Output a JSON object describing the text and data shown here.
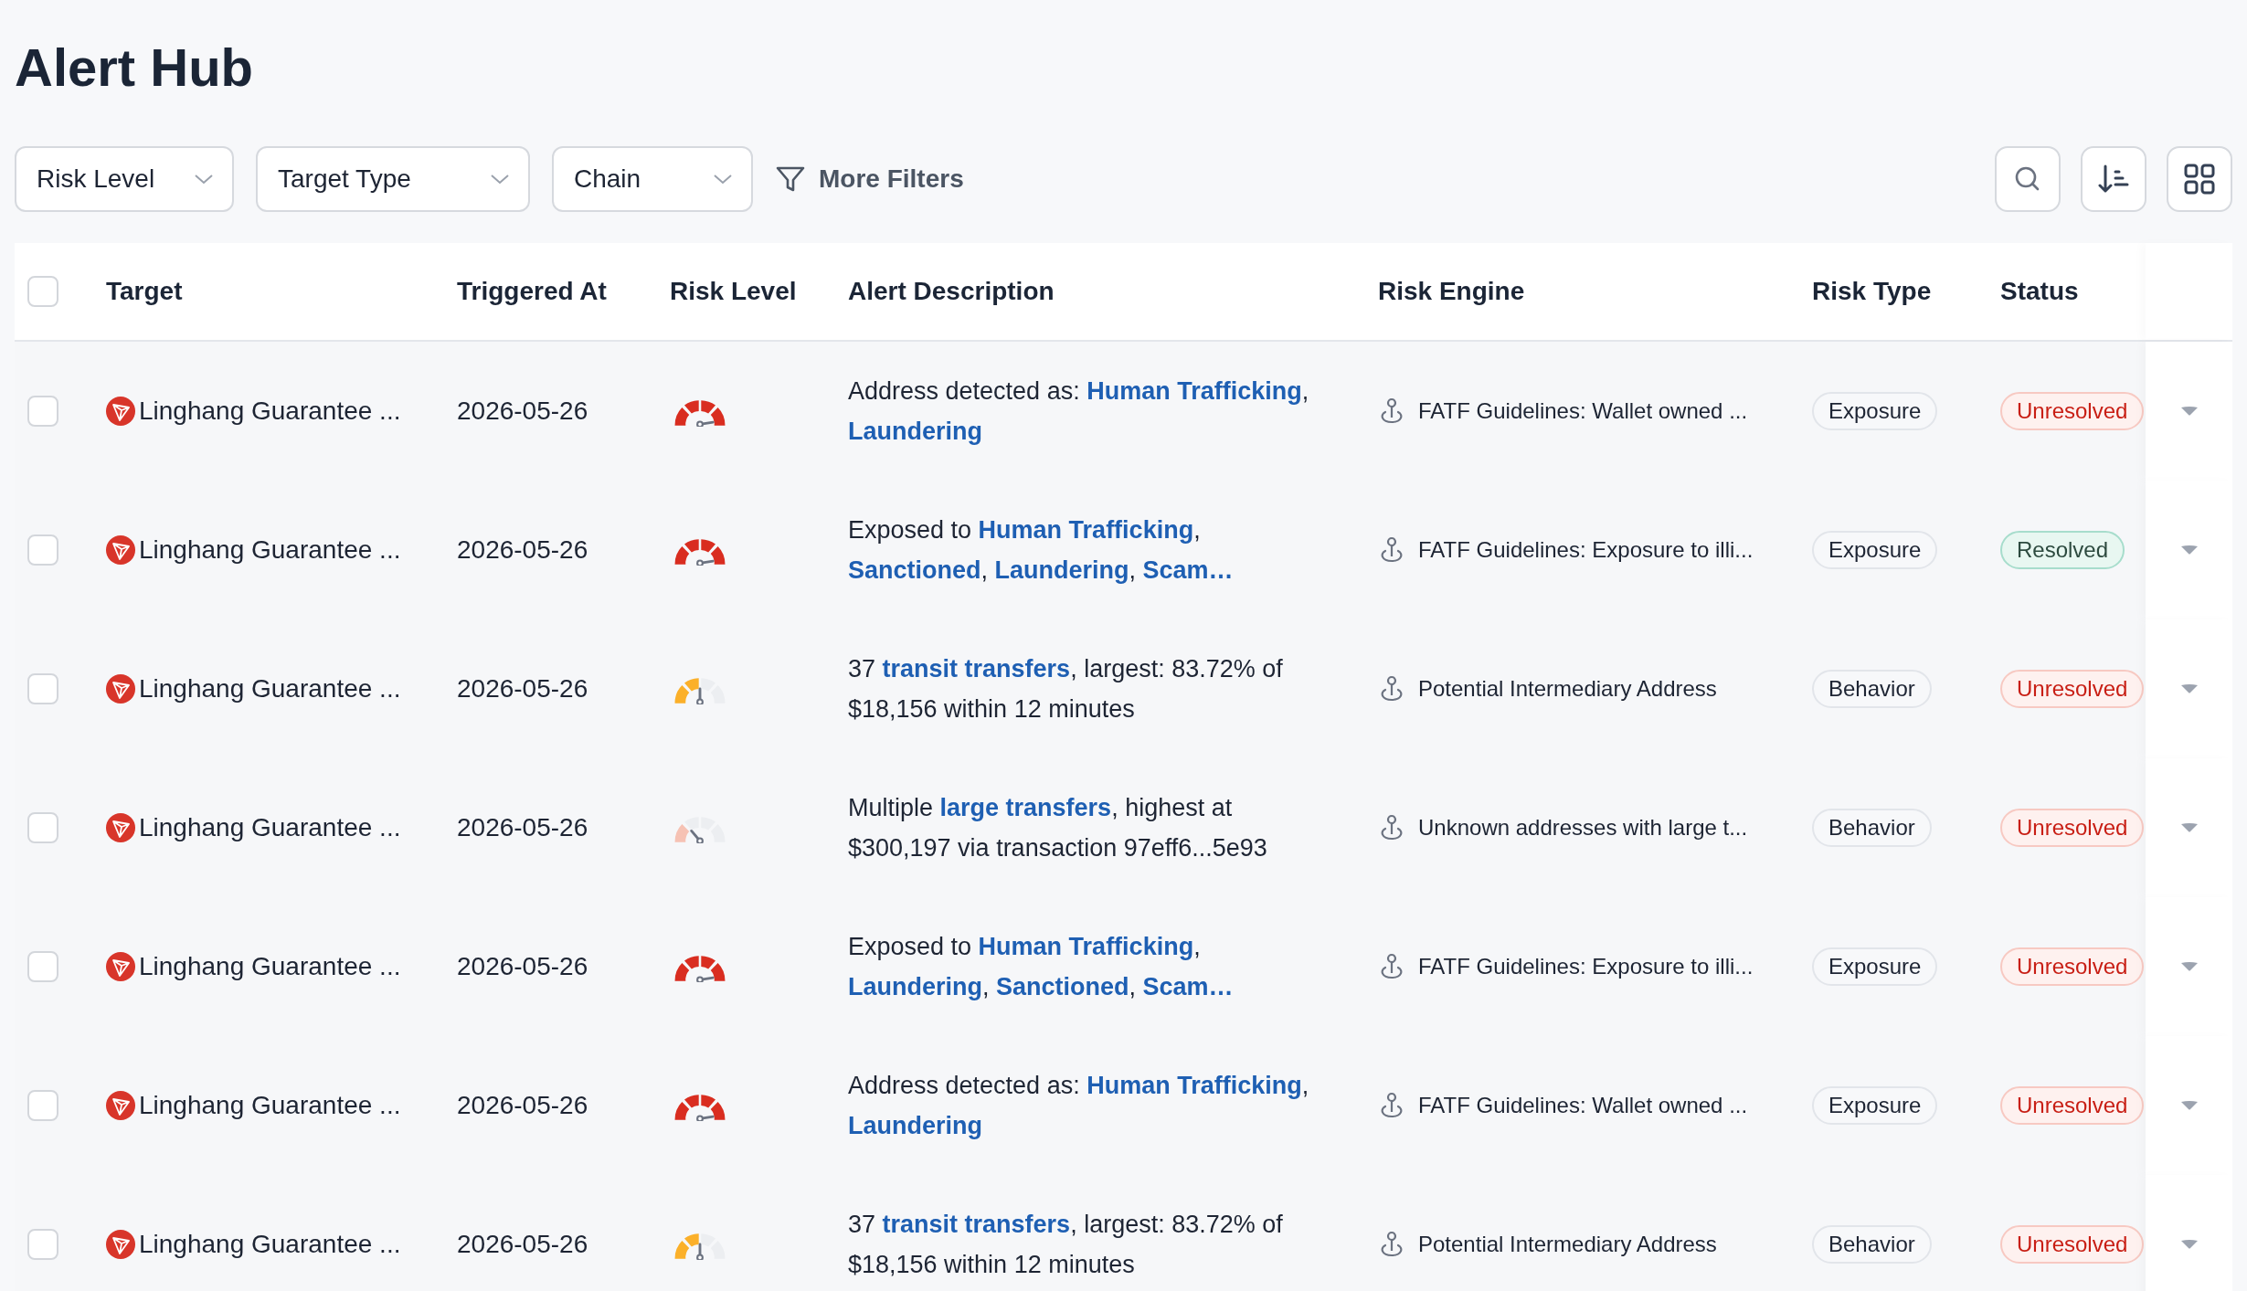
{
  "title": "Alert Hub",
  "filters": [
    {
      "label": "Risk Level"
    },
    {
      "label": "Target Type"
    },
    {
      "label": "Chain"
    }
  ],
  "more_filters": "More Filters",
  "table": {
    "select_all_checked": false,
    "columns": [
      "Target",
      "Triggered At",
      "Risk Level",
      "Alert Description",
      "Risk Engine",
      "Risk Type",
      "Status"
    ],
    "rows": [
      {
        "checked": false,
        "target": "Linghang Guarantee ...",
        "triggered_at": "2026-05-26",
        "level": 1,
        "description": [
          {
            "kind": "text",
            "text": "Address detected as: "
          },
          {
            "kind": "link",
            "text": "Human Trafficking"
          },
          {
            "kind": "text",
            "text": ", "
          },
          {
            "kind": "link",
            "text": "Laundering"
          }
        ],
        "risk_engine": "FATF Guidelines: Wallet owned ...",
        "risk_type": "Exposure",
        "status": "Unresolved",
        "resolved": false
      },
      {
        "checked": false,
        "target": "Linghang Guarantee ...",
        "triggered_at": "2026-05-26",
        "level": 1,
        "description": [
          {
            "kind": "text",
            "text": "Exposed to "
          },
          {
            "kind": "link",
            "text": "Human Trafficking"
          },
          {
            "kind": "text",
            "text": ", "
          },
          {
            "kind": "link",
            "text": "Sanctioned"
          },
          {
            "kind": "text",
            "text": ", "
          },
          {
            "kind": "link",
            "text": "Laundering"
          },
          {
            "kind": "text",
            "text": ", "
          },
          {
            "kind": "link",
            "text": "Scam…"
          }
        ],
        "risk_engine": "FATF Guidelines: Exposure to illi...",
        "risk_type": "Exposure",
        "status": "Resolved",
        "resolved": true
      },
      {
        "checked": false,
        "target": "Linghang Guarantee ...",
        "triggered_at": "2026-05-26",
        "level": 0.5,
        "description": [
          {
            "kind": "text",
            "text": "37 "
          },
          {
            "kind": "link",
            "text": "transit transfers"
          },
          {
            "kind": "text",
            "text": ", largest: 83.72% of $18,156 within 12 minutes"
          }
        ],
        "risk_engine": "Potential Intermediary Address",
        "risk_type": "Behavior",
        "status": "Unresolved",
        "resolved": false
      },
      {
        "checked": false,
        "target": "Linghang Guarantee ...",
        "triggered_at": "2026-05-26",
        "level": 0.25,
        "description": [
          {
            "kind": "text",
            "text": "Multiple "
          },
          {
            "kind": "link",
            "text": "large transfers"
          },
          {
            "kind": "text",
            "text": ", highest at $300,197 via transaction 97eff6...5e93"
          }
        ],
        "risk_engine": "Unknown addresses with large t...",
        "risk_type": "Behavior",
        "status": "Unresolved",
        "resolved": false
      },
      {
        "checked": false,
        "target": "Linghang Guarantee ...",
        "triggered_at": "2026-05-26",
        "level": 1,
        "description": [
          {
            "kind": "text",
            "text": "Exposed to "
          },
          {
            "kind": "link",
            "text": "Human Trafficking"
          },
          {
            "kind": "text",
            "text": ", "
          },
          {
            "kind": "link",
            "text": "Laundering"
          },
          {
            "kind": "text",
            "text": ", "
          },
          {
            "kind": "link",
            "text": "Sanctioned"
          },
          {
            "kind": "text",
            "text": ", "
          },
          {
            "kind": "link",
            "text": "Scam…"
          }
        ],
        "risk_engine": "FATF Guidelines: Exposure to illi...",
        "risk_type": "Exposure",
        "status": "Unresolved",
        "resolved": false
      },
      {
        "checked": false,
        "target": "Linghang Guarantee ...",
        "triggered_at": "2026-05-26",
        "level": 1,
        "description": [
          {
            "kind": "text",
            "text": "Address detected as: "
          },
          {
            "kind": "link",
            "text": "Human Trafficking"
          },
          {
            "kind": "text",
            "text": ", "
          },
          {
            "kind": "link",
            "text": "Laundering"
          }
        ],
        "risk_engine": "FATF Guidelines: Wallet owned ...",
        "risk_type": "Exposure",
        "status": "Unresolved",
        "resolved": false
      },
      {
        "checked": false,
        "target": "Linghang Guarantee ...",
        "triggered_at": "2026-05-26",
        "level": 0.5,
        "description": [
          {
            "kind": "text",
            "text": "37 "
          },
          {
            "kind": "link",
            "text": "transit transfers"
          },
          {
            "kind": "text",
            "text": ", largest: 83.72% of $18,156 within 12 minutes"
          }
        ],
        "risk_engine": "Potential Intermediary Address",
        "risk_type": "Behavior",
        "status": "Unresolved",
        "resolved": false
      }
    ]
  }
}
